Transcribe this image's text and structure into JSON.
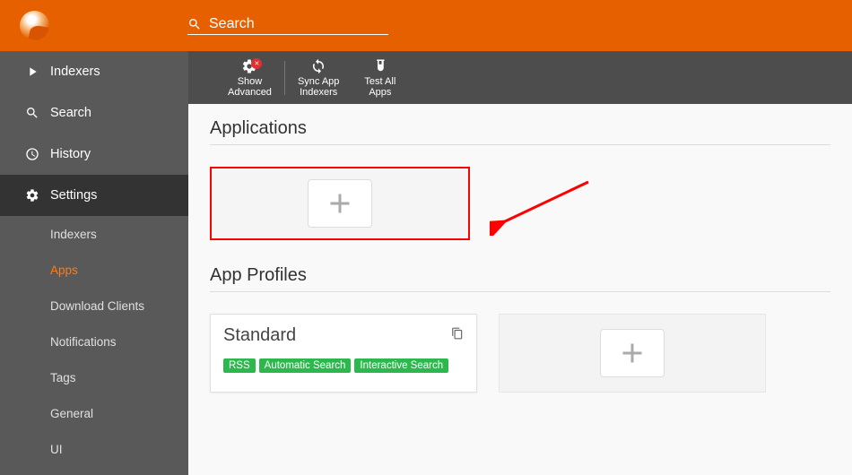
{
  "search": {
    "placeholder": "Search"
  },
  "nav": {
    "indexers": "Indexers",
    "search": "Search",
    "history": "History",
    "settings": "Settings"
  },
  "subnav": {
    "indexers": "Indexers",
    "apps": "Apps",
    "download_clients": "Download Clients",
    "notifications": "Notifications",
    "tags": "Tags",
    "general": "General",
    "ui": "UI"
  },
  "toolbar": {
    "show_advanced_l1": "Show",
    "show_advanced_l2": "Advanced",
    "sync_l1": "Sync App",
    "sync_l2": "Indexers",
    "test_l1": "Test All",
    "test_l2": "Apps"
  },
  "sections": {
    "applications": "Applications",
    "app_profiles": "App Profiles"
  },
  "profile": {
    "name": "Standard",
    "badges": [
      "RSS",
      "Automatic Search",
      "Interactive Search"
    ]
  }
}
